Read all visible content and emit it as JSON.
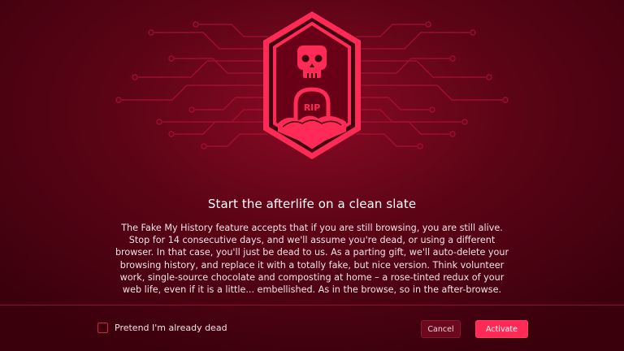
{
  "dialog": {
    "title": "Start the afterlife on a clean slate",
    "body": "The Fake My History feature accepts that if you are still browsing, you are still alive. Stop for 14 consecutive days, and we'll assume you're dead, or using a different browser. In that case, you'll just be dead to us. As a parting gift, we'll auto-delete your browsing history, and replace it with a totally fake, but nice version. Think volunteer work, single-source chocolate and composting at home – a rose-tinted redux of your web life, even if it is a little... embellished. As in the browse, so in the after-browse.",
    "badge": {
      "skull_icon": "skull-icon",
      "tombstone_text": "RIP"
    },
    "checkbox": {
      "label": "Pretend I'm already dead",
      "checked": false
    },
    "buttons": {
      "cancel": "Cancel",
      "activate": "Activate"
    }
  },
  "colors": {
    "accent": "#ff2a55",
    "background": "#5c0416",
    "circuit": "#b01236"
  }
}
